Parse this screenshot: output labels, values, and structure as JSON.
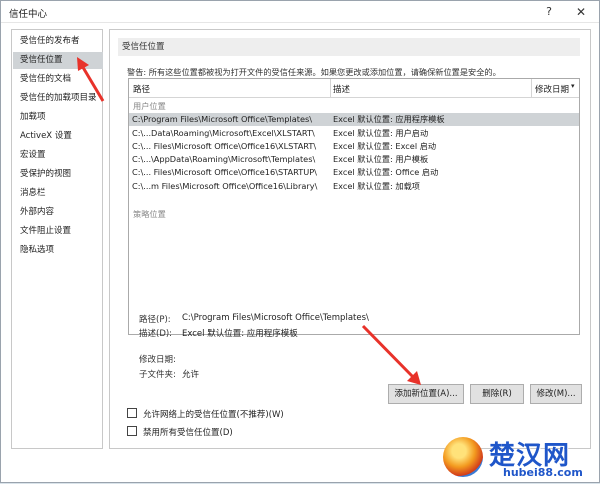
{
  "window": {
    "title": "信任中心",
    "help_label": "?",
    "close_label": "✕"
  },
  "sidebar": {
    "items": [
      {
        "label": "受信任的发布者"
      },
      {
        "label": "受信任位置"
      },
      {
        "label": "受信任的文档"
      },
      {
        "label": "受信任的加载项目录"
      },
      {
        "label": "加载项"
      },
      {
        "label": "ActiveX 设置"
      },
      {
        "label": "宏设置"
      },
      {
        "label": "受保护的视图"
      },
      {
        "label": "消息栏"
      },
      {
        "label": "外部内容"
      },
      {
        "label": "文件阻止设置"
      },
      {
        "label": "隐私选项"
      }
    ],
    "selected_index": 1
  },
  "main": {
    "section_title": "受信任位置",
    "warning": "警告: 所有这些位置都被视为打开文件的受信任来源。如果您更改或添加位置，请确保新位置是安全的。",
    "table": {
      "col_path": "路径",
      "col_desc": "描述",
      "col_date": "修改日期",
      "sort_icon": "sort-down-icon",
      "group_user": "用户位置",
      "group_policy": "策略位置",
      "rows": [
        {
          "path": "C:\\Program Files\\Microsoft Office\\Templates\\",
          "desc": "Excel 默认位置: 应用程序模板"
        },
        {
          "path": "C:\\...Data\\Roaming\\Microsoft\\Excel\\XLSTART\\",
          "desc": "Excel 默认位置: 用户启动"
        },
        {
          "path": "C:\\... Files\\Microsoft Office\\Office16\\XLSTART\\",
          "desc": "Excel 默认位置: Excel 启动"
        },
        {
          "path": "C:\\...\\AppData\\Roaming\\Microsoft\\Templates\\",
          "desc": "Excel 默认位置: 用户模板"
        },
        {
          "path": "C:\\... Files\\Microsoft Office\\Office16\\STARTUP\\",
          "desc": "Excel 默认位置: Office 启动"
        },
        {
          "path": "C:\\...m Files\\Microsoft Office\\Office16\\Library\\",
          "desc": "Excel 默认位置: 加载项"
        }
      ],
      "selected_row": 0
    },
    "details": {
      "path_label": "路径(P):",
      "path_value": "C:\\Program Files\\Microsoft Office\\Templates\\",
      "desc_label": "描述(D):",
      "desc_value": "Excel 默认位置: 应用程序模板",
      "date_label": "修改日期:",
      "subfolders_label": "子文件夹:",
      "subfolders_value": "允许"
    },
    "buttons": {
      "add": "添加新位置(A)...",
      "remove": "删除(R)",
      "modify": "修改(M)..."
    },
    "checkboxes": {
      "allow_network": "允许网络上的受信任位置(不推荐)(W)",
      "disable_all": "禁用所有受信任位置(D)"
    }
  },
  "annotations": {
    "arrow_color": "#e8322a"
  },
  "watermark": {
    "cn": "楚汉网",
    "en": "hubei88.com"
  }
}
